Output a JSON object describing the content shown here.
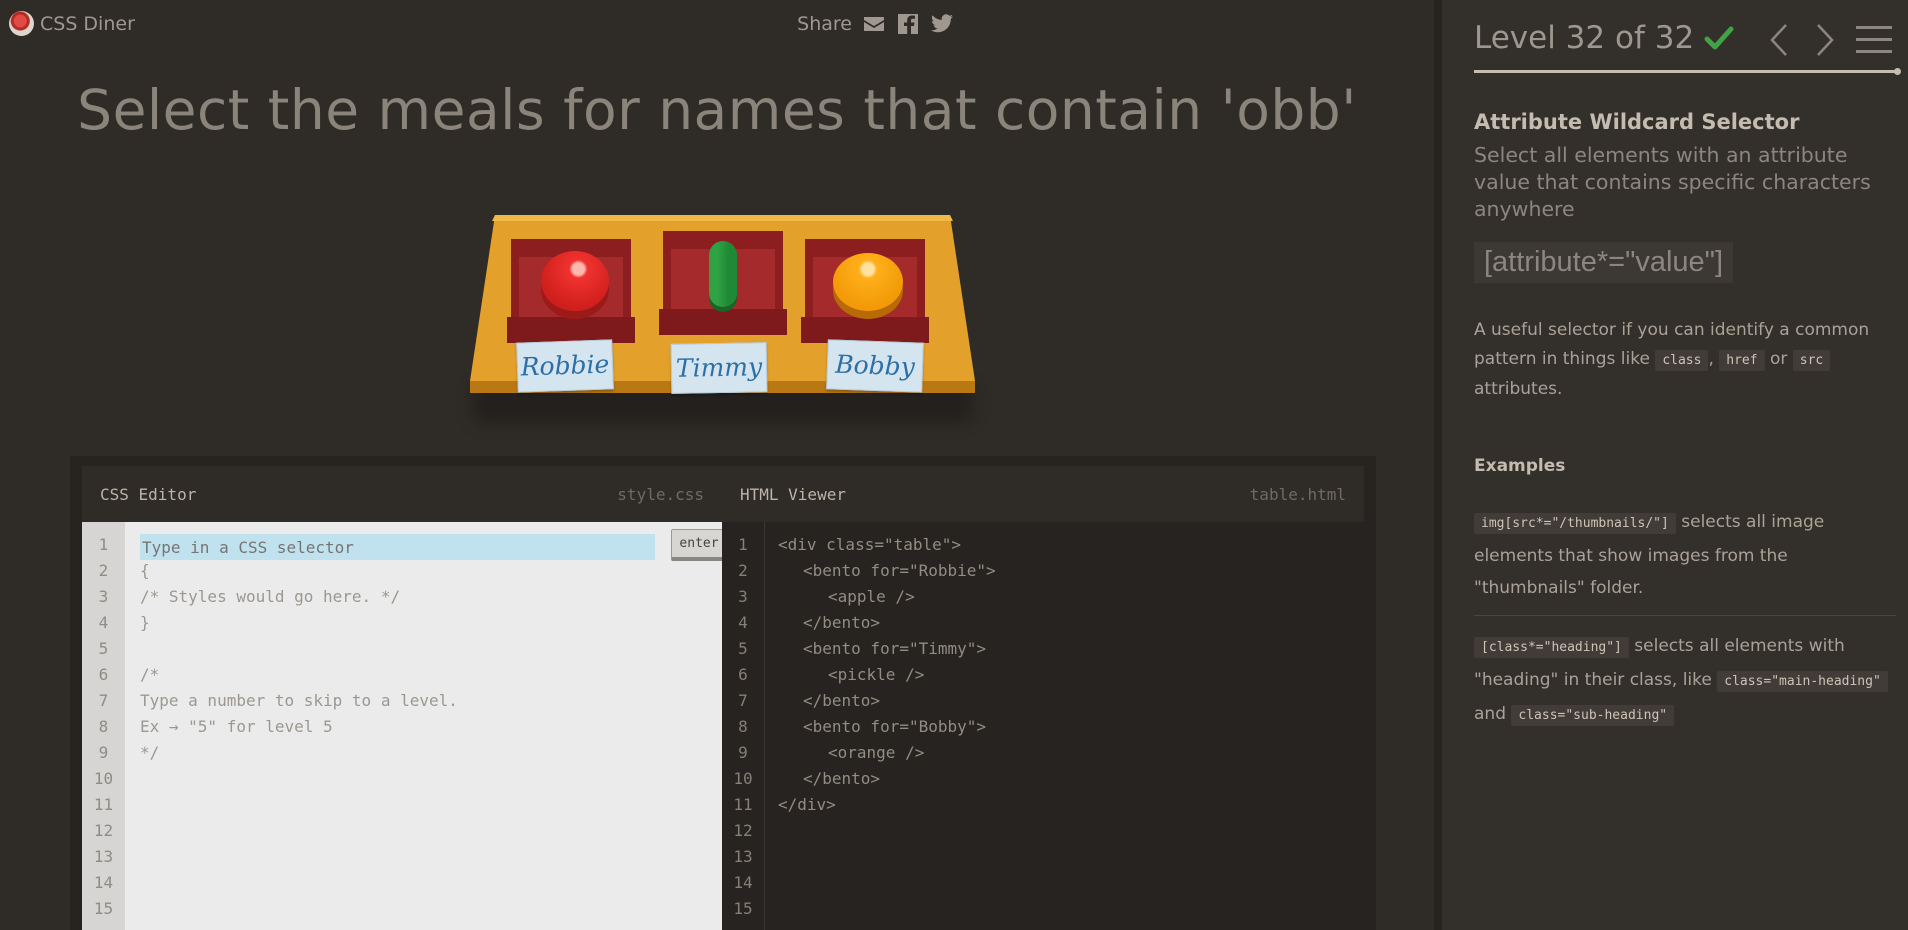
{
  "app": {
    "name": "CSS Diner"
  },
  "share": {
    "label": "Share"
  },
  "instruction": "Select the meals for names that contain 'obb'",
  "table": {
    "plates": [
      {
        "name": "Robbie",
        "food": "apple"
      },
      {
        "name": "Timmy",
        "food": "pickle"
      },
      {
        "name": "Bobby",
        "food": "orange"
      }
    ]
  },
  "css_editor": {
    "title": "CSS Editor",
    "file": "style.css",
    "placeholder": "Type in a CSS selector",
    "enter_label": "enter",
    "line_numbers": [
      "1",
      "2",
      "3",
      "4",
      "5",
      "6",
      "7",
      "8",
      "9",
      "10",
      "11",
      "12",
      "13",
      "14",
      "15"
    ],
    "lines": [
      "",
      "{",
      "/* Styles would go here. */",
      "}",
      "",
      "/*",
      "Type a number to skip to a level.",
      "Ex → \"5\" for level 5",
      "*/"
    ]
  },
  "html_viewer": {
    "title": "HTML Viewer",
    "file": "table.html",
    "line_numbers": [
      "1",
      "2",
      "3",
      "4",
      "5",
      "6",
      "7",
      "8",
      "9",
      "10",
      "11",
      "12",
      "13",
      "14",
      "15"
    ],
    "lines": [
      "<div class=\"table\">",
      "<bento for=\"Robbie\">",
      "<apple />",
      "</bento>",
      "<bento for=\"Timmy\">",
      "<pickle />",
      "</bento>",
      "<bento for=\"Bobby\">",
      "<orange />",
      "</bento>",
      "</div>"
    ]
  },
  "sidebar": {
    "level_label": "Level 32 of 32",
    "progress": 1.0,
    "selector_title": "Attribute Wildcard Selector",
    "selector_desc": "Select all elements with an attribute value that contains specific characters anywhere",
    "syntax": "[attribute*=\"value\"]",
    "hint_pre": "A useful selector if you can identify a common pattern in things like",
    "hint_code1": "class",
    "hint_sep1": ",",
    "hint_code2": "href",
    "hint_sep2": "or",
    "hint_code3": "src",
    "hint_post": "attributes.",
    "examples_title": "Examples",
    "ex1_code": "img[src*=\"/thumbnails/\"]",
    "ex1_text": "selects all image elements that show images from the \"thumbnails\" folder.",
    "ex2_code": "[class*=\"heading\"]",
    "ex2_text": "selects all elements with \"heading\" in their class, like",
    "ex2_code2": "class=\"main-heading\"",
    "ex2_and": "and",
    "ex2_code3": "class=\"sub-heading\""
  },
  "colors": {
    "background": "#2f2b27",
    "sidebar": "#332f2b",
    "table": "#e09c2a",
    "check": "#41a343"
  }
}
